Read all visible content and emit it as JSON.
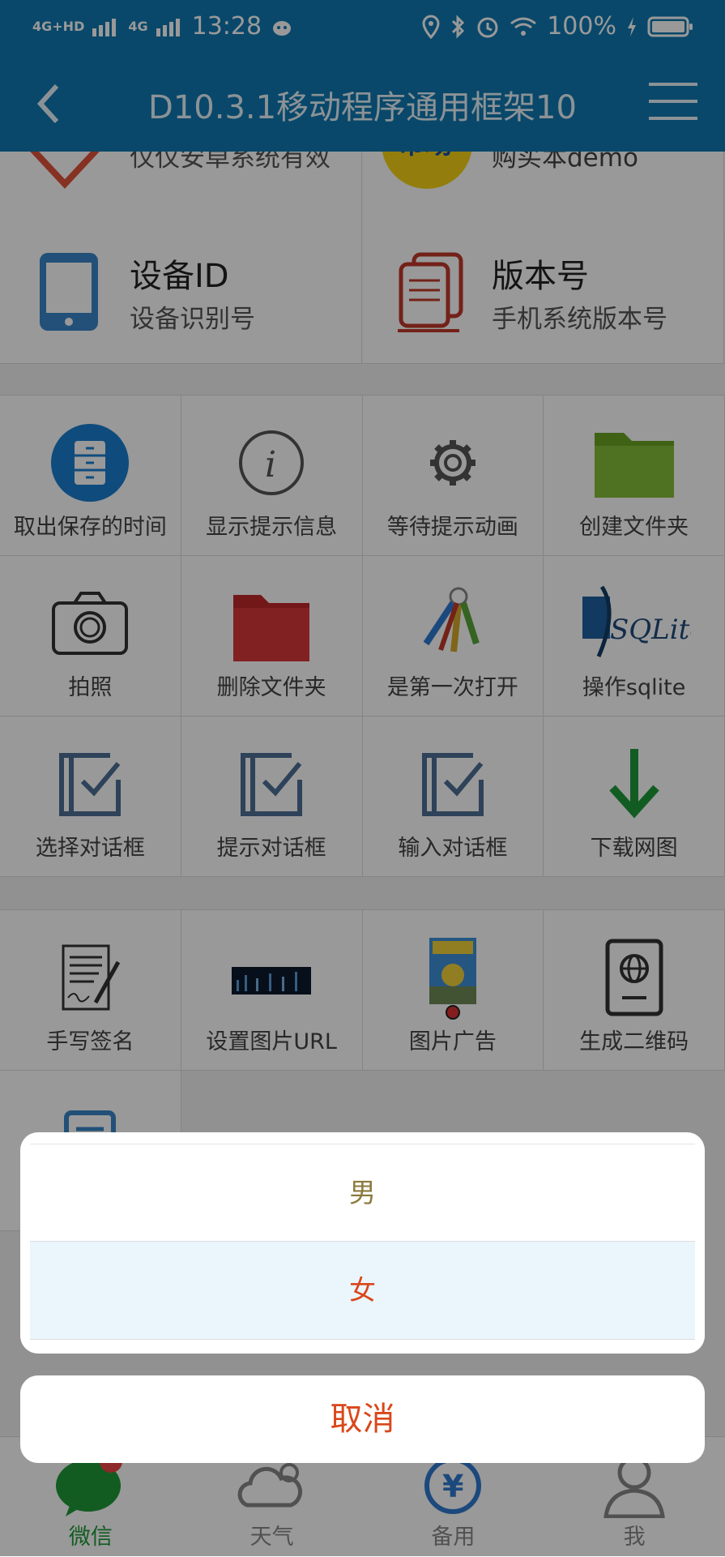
{
  "status": {
    "network1": "4G+HD",
    "network2": "4G",
    "time": "13:28",
    "battery": "100%"
  },
  "navbar": {
    "title": "D10.3.1移动程序通用框架10"
  },
  "top_row": [
    {
      "title": "",
      "sub": "仅仅安卓系统有效",
      "icon": "heart-icon"
    },
    {
      "title": "",
      "sub": "购买本demo",
      "icon": "shopping-badge-icon"
    }
  ],
  "info_row": [
    {
      "title": "设备ID",
      "sub": "设备识别号",
      "icon": "phone-icon"
    },
    {
      "title": "版本号",
      "sub": "手机系统版本号",
      "icon": "documents-icon"
    }
  ],
  "grid1": [
    {
      "label": "取出保存的时间",
      "icon": "cabinet-icon"
    },
    {
      "label": "显示提示信息",
      "icon": "info-icon"
    },
    {
      "label": "等待提示动画",
      "icon": "gear-icon"
    },
    {
      "label": "创建文件夹",
      "icon": "green-folder-icon"
    },
    {
      "label": "拍照",
      "icon": "camera-icon"
    },
    {
      "label": "删除文件夹",
      "icon": "red-folder-icon"
    },
    {
      "label": "是第一次打开",
      "icon": "keys-icon"
    },
    {
      "label": "操作sqlite",
      "icon": "sqlite-icon"
    },
    {
      "label": "选择对话框",
      "icon": "checkbox-icon"
    },
    {
      "label": "提示对话框",
      "icon": "checkbox-icon"
    },
    {
      "label": "输入对话框",
      "icon": "checkbox-icon"
    },
    {
      "label": "下载网图",
      "icon": "download-arrow-icon"
    }
  ],
  "grid2": [
    {
      "label": "手写签名",
      "icon": "signature-icon"
    },
    {
      "label": "设置图片URL",
      "icon": "city-image-icon"
    },
    {
      "label": "图片广告",
      "icon": "poster-icon"
    },
    {
      "label": "生成二维码",
      "icon": "passport-icon"
    },
    {
      "label": "",
      "icon": "document-icon"
    }
  ],
  "sqlite_text": "SQLite",
  "tabs": [
    {
      "label": "微信",
      "icon": "wechat-icon",
      "active": true
    },
    {
      "label": "天气",
      "icon": "weather-icon",
      "active": false
    },
    {
      "label": "备用",
      "icon": "yen-refresh-icon",
      "active": false
    },
    {
      "label": "我",
      "icon": "user-icon",
      "active": false
    }
  ],
  "sheet": {
    "options": [
      "男",
      "女"
    ],
    "cancel": "取消"
  },
  "colors": {
    "brand": "#0f79b1",
    "accent": "#d9471b",
    "male_text": "#8b7a3c",
    "active_tab": "#1f9a3a"
  }
}
